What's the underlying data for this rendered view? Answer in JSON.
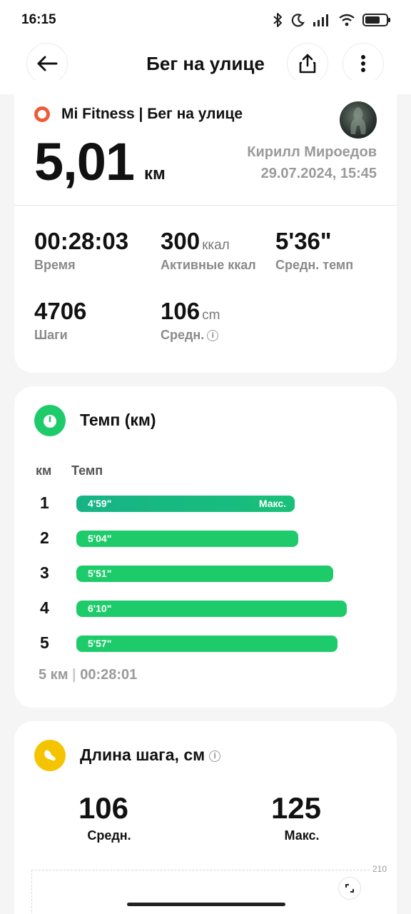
{
  "status_bar": {
    "time": "16:15",
    "icons": [
      "bluetooth-icon",
      "moon-icon",
      "signal-icon",
      "wifi-icon",
      "battery-icon"
    ],
    "battery_level": 0.7
  },
  "header": {
    "title": "Бег на улице",
    "icons": [
      "back-arrow-icon",
      "share-icon",
      "more-vert-icon"
    ]
  },
  "summary": {
    "source": "Mi Fitness | Бег на улице",
    "distance": "5,01",
    "distance_unit": "км",
    "user_name": "Кирилл Мироедов",
    "datetime": "29.07.2024, 15:45",
    "stats": [
      {
        "value": "00:28:03",
        "unit": "",
        "label": "Время"
      },
      {
        "value": "300",
        "unit": "ккал",
        "label": "Активные ккал"
      },
      {
        "value": "5'36\"",
        "unit": "",
        "label": "Средн. темп"
      },
      {
        "value": "4706",
        "unit": "",
        "label": "Шаги"
      },
      {
        "value": "106",
        "unit": "cm",
        "label": "Средн."
      }
    ],
    "accent_color": "#ef5a3a"
  },
  "pace": {
    "title": "Темп (км)",
    "col_km": "км",
    "col_pace": "Темп",
    "max_label": "Макс.",
    "rows": [
      {
        "km": "1",
        "pace": "4'59\"",
        "seconds": 299,
        "is_max": true
      },
      {
        "km": "2",
        "pace": "5'04\"",
        "seconds": 304,
        "is_max": false
      },
      {
        "km": "3",
        "pace": "5'51\"",
        "seconds": 351,
        "is_max": false
      },
      {
        "km": "4",
        "pace": "6'10\"",
        "seconds": 370,
        "is_max": false
      },
      {
        "km": "5",
        "pace": "5'57\"",
        "seconds": 357,
        "is_max": false
      }
    ],
    "total_km": "5 км",
    "total_time": "00:28:01",
    "bar_color": "#1ecb6b"
  },
  "stride": {
    "title": "Длина шага, см",
    "avg_value": "106",
    "avg_label": "Средн.",
    "max_value": "125",
    "max_label": "Макс.",
    "chart_axis_max": "210",
    "icon_color": "#f5c400"
  }
}
